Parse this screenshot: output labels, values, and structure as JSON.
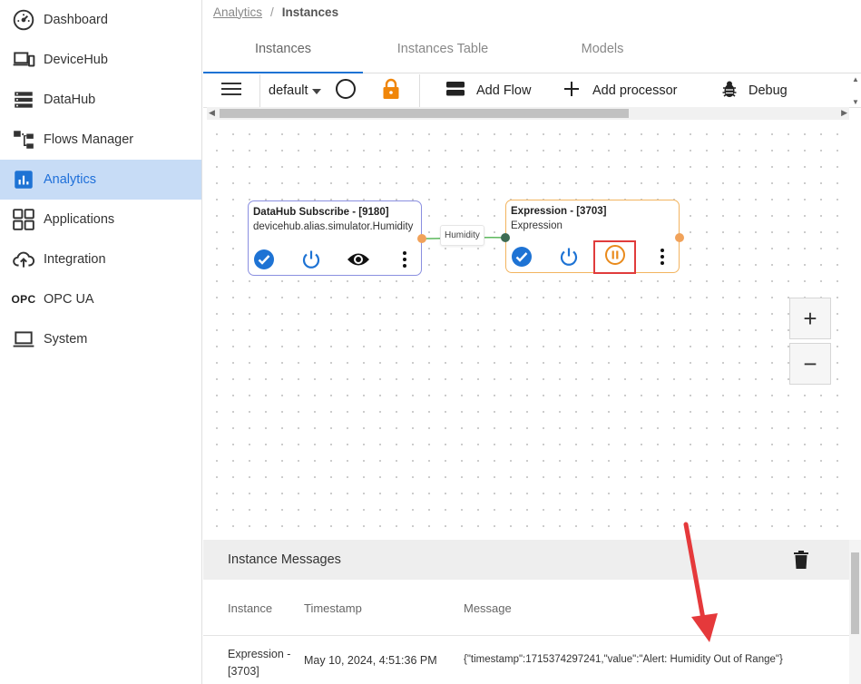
{
  "sidebar": {
    "items": [
      {
        "label": "Dashboard",
        "icon": "gauge-icon"
      },
      {
        "label": "DeviceHub",
        "icon": "devices-icon"
      },
      {
        "label": "DataHub",
        "icon": "database-icon"
      },
      {
        "label": "Flows Manager",
        "icon": "flows-icon"
      },
      {
        "label": "Analytics",
        "icon": "analytics-icon",
        "active": true
      },
      {
        "label": "Applications",
        "icon": "apps-grid-icon"
      },
      {
        "label": "Integration",
        "icon": "cloud-upload-icon"
      },
      {
        "label": "OPC UA",
        "icon": "opc-text-icon",
        "icon_text": "OPC"
      },
      {
        "label": "System",
        "icon": "laptop-icon"
      }
    ]
  },
  "breadcrumb": {
    "parent": "Analytics",
    "separator": "/",
    "current": "Instances"
  },
  "tabs": [
    {
      "label": "Instances",
      "active": true
    },
    {
      "label": "Instances Table"
    },
    {
      "label": "Models"
    }
  ],
  "toolbar": {
    "flow_select": "default",
    "add_flow": "Add Flow",
    "add_processor": "Add processor",
    "debug": "Debug"
  },
  "nodes": {
    "subscribe": {
      "title": "DataHub Subscribe - [9180]",
      "subtitle": "devicehub.alias.simulator.Humidity"
    },
    "expression": {
      "title": "Expression - [3703]",
      "subtitle": "Expression"
    }
  },
  "edge": {
    "label": "Humidity"
  },
  "zoom": {
    "in": "+",
    "out": "−"
  },
  "messages": {
    "title": "Instance Messages",
    "columns": [
      "Instance",
      "Timestamp",
      "Message"
    ],
    "rows": [
      {
        "instance": "Expression - [3703]",
        "timestamp": "May 10, 2024, 4:51:36 PM",
        "message": "{\"timestamp\":1715374297241,\"value\":\"Alert: Humidity Out of Range\"}"
      }
    ]
  },
  "colors": {
    "accent": "#1e73d4",
    "active_bg": "#c7dcf6",
    "node_blue_border": "#8a8fe0",
    "node_orange_border": "#f3b45f",
    "port_orange": "#f1a25a",
    "port_green": "#3e6b52",
    "edge_green": "#5cb85c",
    "highlight_red": "#e03c3c",
    "lock_orange": "#f0860a",
    "pause_orange": "#e98a1c"
  }
}
